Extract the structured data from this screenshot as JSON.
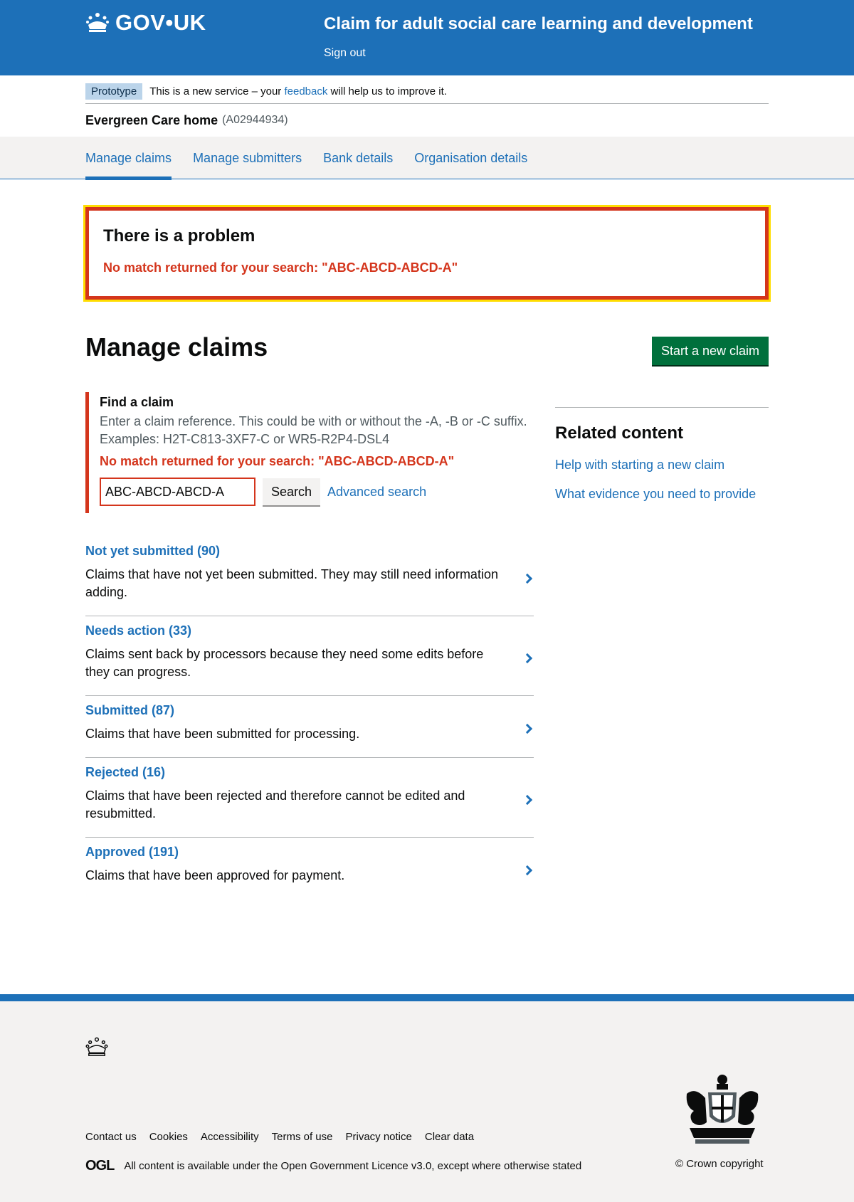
{
  "header": {
    "logo_text": "GOV•UK",
    "service_name": "Claim for adult social care learning and development",
    "sign_out": "Sign out"
  },
  "phase_banner": {
    "tag": "Prototype",
    "text_before": "This is a new service – your ",
    "feedback_link": "feedback",
    "text_after": " will help us to improve it."
  },
  "organisation": {
    "name": "Evergreen Care home",
    "reference": "(A02944934)"
  },
  "subnav": {
    "items": [
      {
        "label": "Manage claims",
        "active": true
      },
      {
        "label": "Manage submitters"
      },
      {
        "label": "Bank details"
      },
      {
        "label": "Organisation details"
      }
    ]
  },
  "error_summary": {
    "title": "There is a problem",
    "message": "No match returned for your search: \"ABC-ABCD-ABCD-A\""
  },
  "page": {
    "title": "Manage claims",
    "start_button": "Start a new claim"
  },
  "find": {
    "label": "Find a claim",
    "hint_line1": "Enter a claim reference. This could be with or without the -A, -B or -C suffix.",
    "hint_line2": "Examples: H2T-C813-3XF7-C or WR5-R2P4-DSL4",
    "error": "No match returned for your search: \"ABC-ABCD-ABCD-A\"",
    "value": "ABC-ABCD-ABCD-A",
    "search_button": "Search",
    "advanced_link": "Advanced search"
  },
  "claims": [
    {
      "title": "Not yet submitted (90)",
      "description": "Claims that have not yet been submitted. They may still need information adding."
    },
    {
      "title": "Needs action (33)",
      "description": "Claims sent back by processors because they need some edits before they can progress."
    },
    {
      "title": "Submitted (87)",
      "description": "Claims that have been submitted for processing."
    },
    {
      "title": "Rejected (16)",
      "description": "Claims that have been rejected and therefore cannot be edited and resubmitted."
    },
    {
      "title": "Approved (191)",
      "description": "Claims that have been approved for payment."
    }
  ],
  "related": {
    "title": "Related content",
    "links": [
      "Help with starting a new claim",
      "What evidence you need to provide"
    ]
  },
  "footer": {
    "links": [
      "Contact us",
      "Cookies",
      "Accessibility",
      "Terms of use",
      "Privacy notice",
      "Clear data"
    ],
    "ogl": "OGL",
    "licence_before": "All content is available under the ",
    "licence_link": "Open Government Licence v3.0",
    "licence_after": ", except where otherwise stated",
    "copyright": "© Crown copyright"
  },
  "colors": {
    "brand": "#1d70b8",
    "error": "#d4351c",
    "focus": "#ffdd00",
    "start_button": "#00703c"
  }
}
